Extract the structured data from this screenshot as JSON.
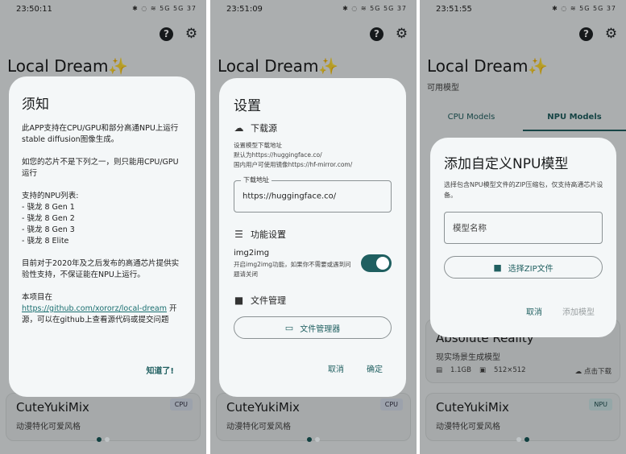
{
  "status_bar": {
    "times": [
      "23:50:11",
      "23:51:09",
      "23:51:55"
    ],
    "icons_text": "✱ ◌ ≋ 5G 5G 37"
  },
  "app": {
    "title": "Local Dream",
    "sparkle": "✨",
    "subtitle": "可用模型"
  },
  "icons": {
    "help": "?",
    "settings": "⚙"
  },
  "screen1": {
    "dialog": {
      "title": "须知",
      "paragraphs": [
        "此APP支持在CPU/GPU和部分高通NPU上运行stable diffusion图像生成。",
        "如您的芯片不是下列之一，则只能用CPU/GPU运行"
      ],
      "npu_header": "支持的NPU列表:",
      "npu_list": [
        "- 骁龙 8 Gen 1",
        "- 骁龙 8 Gen 2",
        "- 骁龙 8 Gen 3",
        "- 骁龙 8 Elite"
      ],
      "experimental_note": "目前对于2020年及之后发布的高通芯片提供实验性支持，不保证能在NPU上运行。",
      "project_prefix": "本项目在",
      "project_link": "https://github.com/xororz/local-dream",
      "project_suffix": "开源，可以在github上查看源代码或提交问题",
      "confirm": "知道了!"
    },
    "card": {
      "title": "CuteYukiMix",
      "desc": "动漫特化可爱风格",
      "badge": "CPU"
    }
  },
  "screen2": {
    "dialog": {
      "title": "设置",
      "download_section": "下载源",
      "download_desc_1": "设置模型下载地址",
      "download_desc_2": "默认为https://huggingface.co/",
      "download_desc_3": "国内用户可使用镜像https://hf-mirror.com/",
      "field_label": "下载地址",
      "field_value": "https://huggingface.co/",
      "features_section": "功能设置",
      "img2img_label": "img2img",
      "img2img_desc": "开启img2img功能，如果你不需要或遇到问题请关闭",
      "img2img_enabled": true,
      "files_section": "文件管理",
      "file_manager_button": "文件管理器",
      "cancel": "取消",
      "ok": "确定"
    },
    "card": {
      "title": "CuteYukiMix",
      "desc": "动漫特化可爱风格",
      "badge": "CPU"
    }
  },
  "screen3": {
    "tabs": [
      "CPU Models",
      "NPU Models"
    ],
    "active_tab": "NPU Models",
    "dialog": {
      "title": "添加自定义NPU模型",
      "desc": "选择包含NPU模型文件的ZIP压缩包，仅支持高通芯片设备。",
      "name_placeholder": "模型名称",
      "zip_button": "选择ZIP文件",
      "cancel": "取消",
      "add": "添加模型"
    },
    "card_1": {
      "title": "Absolute Reality",
      "desc": "现实场景生成模型",
      "size": "1.1GB",
      "resolution": "512×512",
      "download": "点击下载"
    },
    "card_2": {
      "title": "CuteYukiMix",
      "desc": "动漫特化可爱风格",
      "badge": "NPU"
    }
  },
  "pager": {
    "dots": 2
  }
}
